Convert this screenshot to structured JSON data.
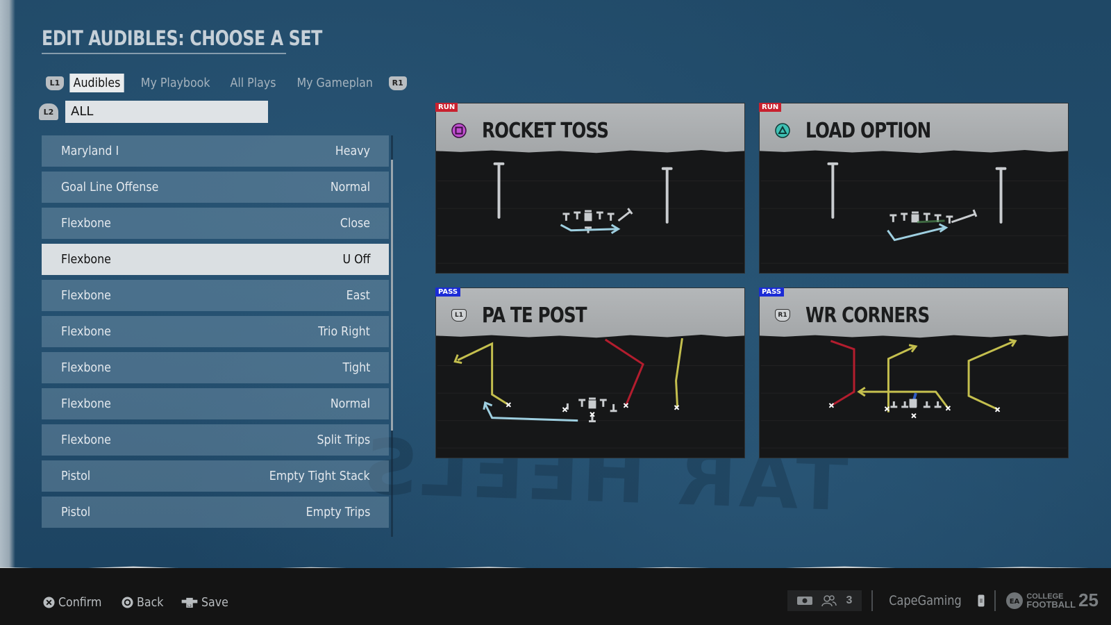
{
  "header": {
    "title": "EDIT AUDIBLES: CHOOSE A SET"
  },
  "tabs": {
    "left_bumper": "L1",
    "right_bumper": "R1",
    "items": [
      {
        "label": "Audibles",
        "active": true
      },
      {
        "label": "My Playbook",
        "active": false
      },
      {
        "label": "All Plays",
        "active": false
      },
      {
        "label": "My Gameplan",
        "active": false
      }
    ]
  },
  "filter": {
    "bumper": "L2",
    "value": "ALL"
  },
  "formations": [
    {
      "formation": "Maryland I",
      "set": "Heavy",
      "selected": false
    },
    {
      "formation": "Goal Line Offense",
      "set": "Normal",
      "selected": false
    },
    {
      "formation": "Flexbone",
      "set": "Close",
      "selected": false
    },
    {
      "formation": "Flexbone",
      "set": "U Off",
      "selected": true
    },
    {
      "formation": "Flexbone",
      "set": "East",
      "selected": false
    },
    {
      "formation": "Flexbone",
      "set": "Trio Right",
      "selected": false
    },
    {
      "formation": "Flexbone",
      "set": "Tight",
      "selected": false
    },
    {
      "formation": "Flexbone",
      "set": "Normal",
      "selected": false
    },
    {
      "formation": "Flexbone",
      "set": "Split Trips",
      "selected": false
    },
    {
      "formation": "Pistol",
      "set": "Empty Tight Stack",
      "selected": false
    },
    {
      "formation": "Pistol",
      "set": "Empty Trips",
      "selected": false
    }
  ],
  "plays": [
    {
      "type": "RUN",
      "name": "ROCKET TOSS",
      "button": "square-button",
      "button_label": ""
    },
    {
      "type": "RUN",
      "name": "LOAD OPTION",
      "button": "triangle-button",
      "button_label": ""
    },
    {
      "type": "PASS",
      "name": "PA TE POST",
      "button": "l1-button",
      "button_label": "L1"
    },
    {
      "type": "PASS",
      "name": "WR CORNERS",
      "button": "r1-button",
      "button_label": "R1"
    }
  ],
  "colors": {
    "run_badge": "#c8212f",
    "pass_badge": "#1b2bd6",
    "route_yellow": "#c4bf4e",
    "route_red": "#b31d2e",
    "route_blue": "#9ecfe0",
    "square_button": "#c04fd0",
    "triangle_button": "#3fc0b4"
  },
  "footer": {
    "hints": [
      {
        "icon": "cross-button-icon",
        "label": "Confirm"
      },
      {
        "icon": "circle-button-icon",
        "label": "Back"
      },
      {
        "icon": "l3-button-icon",
        "label": "Save"
      }
    ],
    "party_count": "3",
    "username": "CapeGaming",
    "brand_line1": "COLLEGE",
    "brand_line2": "FOOTBALL",
    "brand_year": "25"
  }
}
